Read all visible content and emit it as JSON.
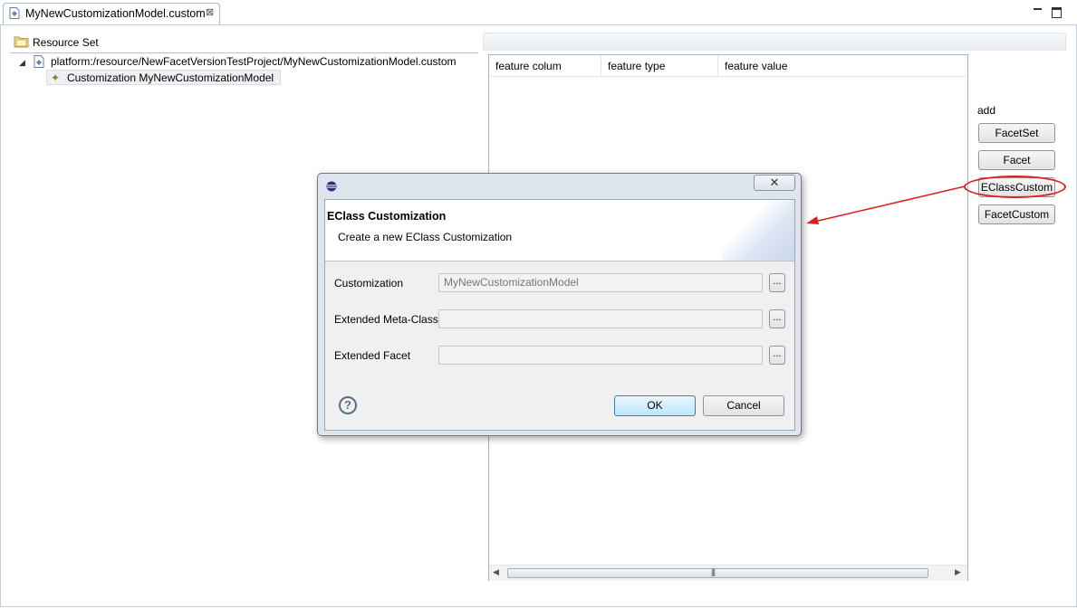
{
  "editor": {
    "tab_title": "MyNewCustomizationModel.custom",
    "tab_close": "⊠"
  },
  "tree": {
    "header": "Resource Set",
    "resource": "platform:/resource/NewFacetVersionTestProject/MyNewCustomizationModel.custom",
    "customization": "Customization MyNewCustomizationModel"
  },
  "table": {
    "columns": [
      "feature colum",
      "feature type",
      "feature value"
    ]
  },
  "add_panel": {
    "label": "add",
    "buttons": [
      "FacetSet",
      "Facet",
      "EClassCustom",
      "FacetCustom"
    ]
  },
  "dialog": {
    "title": "EClass Customization",
    "subtitle": "Create a new EClass Customization",
    "close_glyph": "✕",
    "fields": [
      {
        "label": "Customization",
        "value": "MyNewCustomizationModel"
      },
      {
        "label": "Extended Meta-Class",
        "value": ""
      },
      {
        "label": "Extended Facet",
        "value": ""
      }
    ],
    "browse_label": "...",
    "help_glyph": "?",
    "ok_label": "OK",
    "cancel_label": "Cancel"
  },
  "colors": {
    "annotation_red": "#e02020",
    "ok_border": "#3c7fb1"
  }
}
